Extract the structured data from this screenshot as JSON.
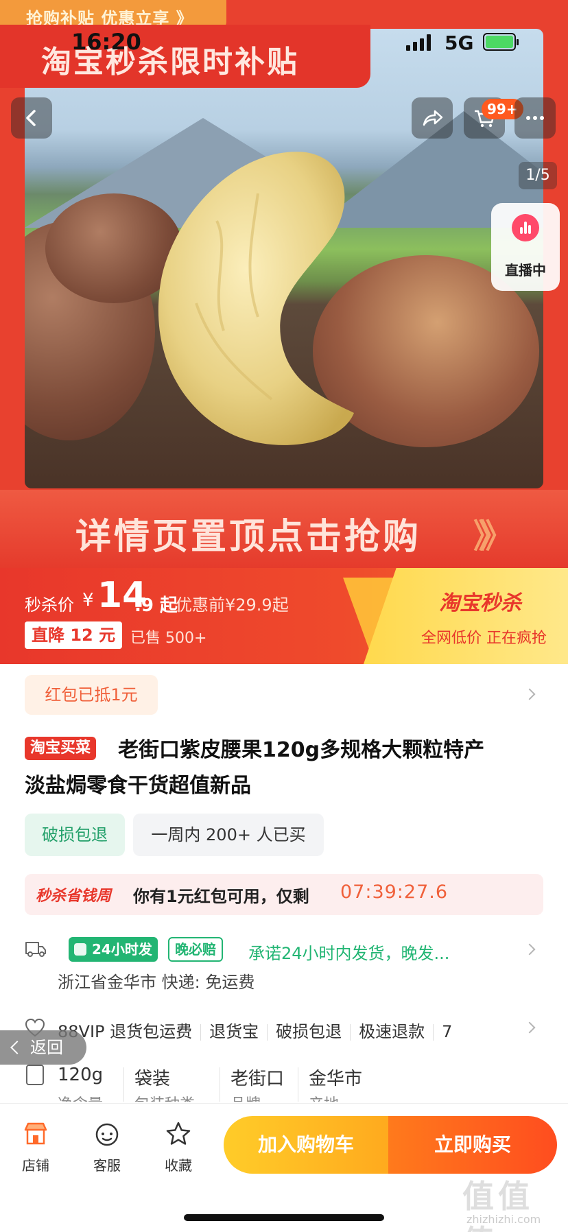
{
  "status_bar": {
    "time": "16:20",
    "network": "5G"
  },
  "hero": {
    "top_strip": "抢购补贴  优惠立享 》",
    "banner": "淘宝秒杀限时补贴",
    "detail_strip": "详情页置顶点击抢购",
    "detail_arrows": "》》",
    "cart_badge": "99+",
    "pager": "1/5",
    "live_label": "直播中"
  },
  "price": {
    "label": "秒杀价",
    "currency": "¥",
    "integer": "14",
    "decimal": ".9 起",
    "before": "优惠前¥29.9起",
    "drop_tag": "直降 12 元",
    "sold": "已售 500+",
    "promo_title": "淘宝秒杀",
    "promo_sub": "全网低价 正在疯抢"
  },
  "coupon": "红包已抵1元",
  "product": {
    "tag": "淘宝买菜",
    "title_line1": "老街口紫皮腰果120g多规格大颗粒特产",
    "title_line2": "淡盐焗零食干货超值新品"
  },
  "services": {
    "s1": "破损包退",
    "s2": "一周内 200+ 人已买"
  },
  "flash": {
    "tag": "秒杀省钱周",
    "text": "你有1元红包可用，仅剩",
    "timer": "07:39:27.6"
  },
  "shipping": {
    "badge_24h": "24小时发",
    "badge_late": "晚必赔",
    "promise": "承诺24小时内发货，晚发...",
    "origin": "浙江省金华市  快递: 免运费"
  },
  "guarantees": [
    "88VIP 退货包运费",
    "退货宝",
    "破损包退",
    "极速退款",
    "7"
  ],
  "back_float": "返回",
  "specs": [
    {
      "value": "120g",
      "label": "净含量"
    },
    {
      "value": "袋装",
      "label": "包装种类"
    },
    {
      "value": "老街口",
      "label": "品牌"
    },
    {
      "value": "金华市",
      "label": "产地"
    }
  ],
  "bottom": {
    "store": "店铺",
    "service": "客服",
    "favorite": "收藏",
    "add_cart": "加入购物车",
    "buy_now": "立即购买"
  },
  "watermark": {
    "text": "值值值",
    "url": "zhizhizhi.com"
  },
  "colors": {
    "accent_red": "#e8372b",
    "accent_orange": "#ff4d1f",
    "accent_yellow": "#ffcc29",
    "green": "#22b573"
  }
}
